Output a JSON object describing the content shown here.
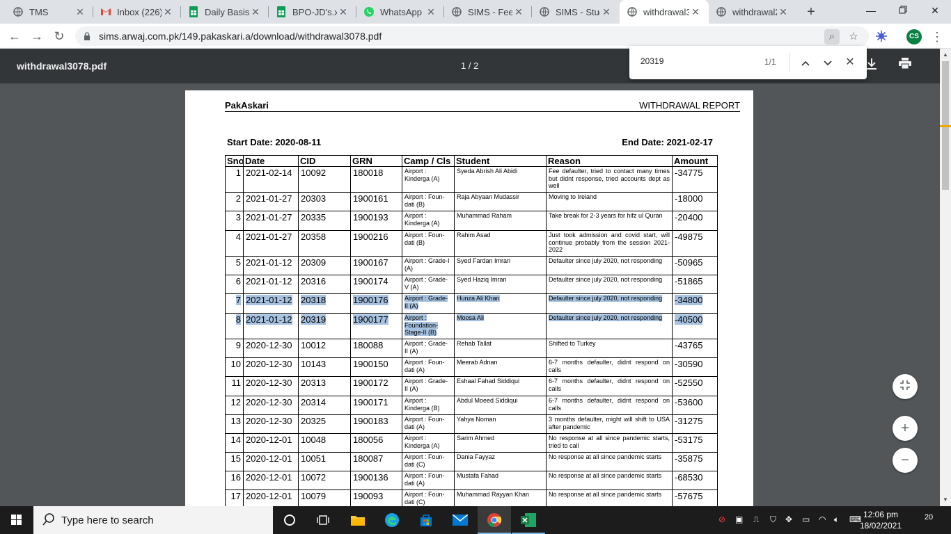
{
  "browser": {
    "tabs": [
      {
        "title": "TMS",
        "icon": "globe-icon"
      },
      {
        "title": "Inbox (226) - ",
        "icon": "gmail-icon"
      },
      {
        "title": "Daily Basis (",
        "icon": "sheets-icon"
      },
      {
        "title": "BPO-JD's.xls",
        "icon": "sheets-icon"
      },
      {
        "title": "WhatsApp",
        "icon": "whatsapp-icon"
      },
      {
        "title": "SIMS - Fee_",
        "icon": "globe-icon"
      },
      {
        "title": "SIMS - Stud",
        "icon": "globe-icon"
      },
      {
        "title": "withdrawal3",
        "icon": "globe-icon"
      },
      {
        "title": "withdrawal2",
        "icon": "globe-icon"
      }
    ],
    "url": "sims.arwaj.com.pk/149.pakaskari.a/download/withdrawal3078.pdf",
    "profile_initials": "CS"
  },
  "pdf": {
    "filename": "withdrawal3078.pdf",
    "page_indicator": "1 / 2"
  },
  "find": {
    "query": "20319",
    "count": "1/1"
  },
  "doc": {
    "brand": "PakAskari",
    "heading": "WITHDRAWAL REPORT",
    "start_date": "Start Date: 2020-08-11",
    "end_date": "End Date: 2021-02-17",
    "columns": [
      "Sno",
      "Date",
      "CID",
      "GRN",
      "Camp / Cls",
      "Student",
      "Reason",
      "Amount"
    ],
    "rows": [
      {
        "sno": "1",
        "date": "2021-02-14",
        "cid": "10092",
        "grn": "180018",
        "camp": "Airport : Kinderga (A)",
        "student": "Syeda Abrish Ali Abidi",
        "reason": "Fee defaulter, tried to contact many times but didnt response, tried accounts dept as well",
        "amount": "-34775"
      },
      {
        "sno": "2",
        "date": "2021-01-27",
        "cid": "20303",
        "grn": "1900161",
        "camp": "Airport : Foun- dati (B)",
        "student": "Raja Abyaan Mudassir",
        "reason": "Moving to Ireland",
        "amount": "-18000"
      },
      {
        "sno": "3",
        "date": "2021-01-27",
        "cid": "20335",
        "grn": "1900193",
        "camp": "Airport : Kinderga (A)",
        "student": "Muhammad Raham",
        "reason": "Take break for 2-3 years for hifz ul Quran",
        "amount": "-20400"
      },
      {
        "sno": "4",
        "date": "2021-01-27",
        "cid": "20358",
        "grn": "1900216",
        "camp": "Airport : Foun- dati (B)",
        "student": "Rahim Asad",
        "reason": "Just took admission and covid start, will continue probably from the session 2021-2022",
        "amount": "-49875"
      },
      {
        "sno": "5",
        "date": "2021-01-12",
        "cid": "20309",
        "grn": "1900167",
        "camp": "Airport : Grade-I (A)",
        "student": "Syed Fardan Imran",
        "reason": "Defaulter since july 2020, not responding",
        "amount": "-50965"
      },
      {
        "sno": "6",
        "date": "2021-01-12",
        "cid": "20316",
        "grn": "1900174",
        "camp": "Airport : Grade- V (A)",
        "student": "Syed Haziq Imran",
        "reason": "Defaulter since july 2020, not responding",
        "amount": "-51865"
      },
      {
        "sno": "7",
        "date": "2021-01-12",
        "cid": "20318",
        "grn": "1900176",
        "camp": "Airport : Grade- II (A)",
        "student": "Hunza Ali Khan",
        "reason": "Defaulter since july 2020, not responding",
        "amount": "-34800"
      },
      {
        "sno": "8",
        "date": "2021-01-12",
        "cid": "20319",
        "grn": "1900177",
        "camp": "Airport : Foundation- Stage-II (B)",
        "student": "Moosa Ali",
        "reason": "Defaulter since july 2020, not responding",
        "amount": "-40500"
      },
      {
        "sno": "9",
        "date": "2020-12-30",
        "cid": "10012",
        "grn": "180088",
        "camp": "Airport : Grade- II (A)",
        "student": "Rehab Tallat",
        "reason": "Shifted to Turkey",
        "amount": "-43765"
      },
      {
        "sno": "10",
        "date": "2020-12-30",
        "cid": "10143",
        "grn": "1900150",
        "camp": "Airport : Foun- dati (A)",
        "student": "Meerab Adnan",
        "reason": "6-7 months defaulter, didnt respond on calls",
        "amount": "-30590"
      },
      {
        "sno": "11",
        "date": "2020-12-30",
        "cid": "20313",
        "grn": "1900172",
        "camp": "Airport : Grade- II (A)",
        "student": "Eshaal Fahad Siddiqui",
        "reason": "6-7 months defaulter, didnt respond on calls",
        "amount": "-52550"
      },
      {
        "sno": "12",
        "date": "2020-12-30",
        "cid": "20314",
        "grn": "1900171",
        "camp": "Airport : Kinderga (B)",
        "student": "Abdul Moeed Siddiqui",
        "reason": "6-7 months defaulter, didnt respond on calls",
        "amount": "-53600"
      },
      {
        "sno": "13",
        "date": "2020-12-30",
        "cid": "20325",
        "grn": "1900183",
        "camp": "Airport : Foun- dati (A)",
        "student": "Yahya Noman",
        "reason": "3 months defaulter, might will shift to USA after pandemic",
        "amount": "-31275"
      },
      {
        "sno": "14",
        "date": "2020-12-01",
        "cid": "10048",
        "grn": "180056",
        "camp": "Airport : Kinderga (A)",
        "student": "Sarim Ahmed",
        "reason": "No response at all since pandemic starts, tried to call",
        "amount": "-53175"
      },
      {
        "sno": "15",
        "date": "2020-12-01",
        "cid": "10051",
        "grn": "180087",
        "camp": "Airport : Foun- dati (C)",
        "student": "Dania Fayyaz",
        "reason": "No response at all since pandemic starts",
        "amount": "-35875"
      },
      {
        "sno": "16",
        "date": "2020-12-01",
        "cid": "10072",
        "grn": "1900136",
        "camp": "Airport : Foun- dati (A)",
        "student": "Mustafa Fahad",
        "reason": "No response at all since pandemic starts",
        "amount": "-68530"
      },
      {
        "sno": "17",
        "date": "2020-12-01",
        "cid": "10079",
        "grn": "190093",
        "camp": "Airport : Foun- dati (C)",
        "student": "Muhammad Rayyan Khan",
        "reason": "No response at all since pandemic starts",
        "amount": "-57675"
      }
    ],
    "highlighted_rows": [
      7,
      8
    ]
  },
  "taskbar": {
    "search_placeholder": "Type here to search",
    "time": "12:06 pm",
    "date": "18/02/2021",
    "notifications": "20"
  },
  "colors": {
    "highlight": "#a6c2e0",
    "pdf_toolbar": "#323639",
    "viewer_bg": "#525659"
  }
}
